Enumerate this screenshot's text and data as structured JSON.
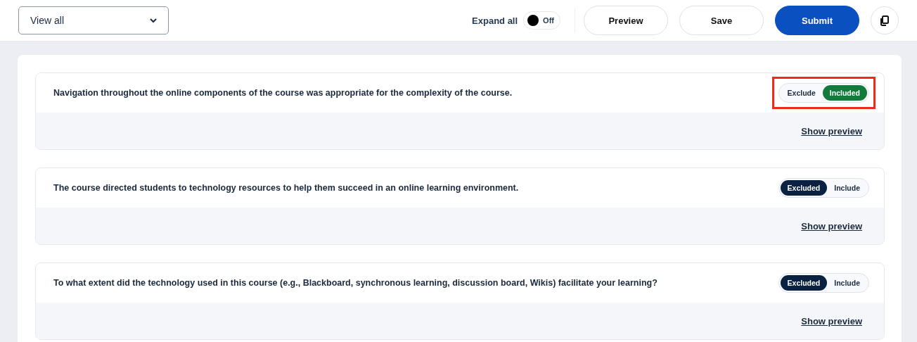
{
  "toolbar": {
    "filter": {
      "value": "View all"
    },
    "expand_all": {
      "label": "Expand all",
      "on": false,
      "state_label": "Off"
    },
    "buttons": [
      {
        "label": "Preview",
        "kind": "outline"
      },
      {
        "label": "Save",
        "kind": "outline"
      },
      {
        "label": "Submit",
        "kind": "primary"
      }
    ]
  },
  "questions": [
    {
      "text": "Navigation throughout the online components of the course was appropriate for the complexity of the course.",
      "highlighted": true,
      "options": [
        {
          "label": "Exclude",
          "selected": false
        },
        {
          "label": "Included",
          "selected": true
        }
      ],
      "link": "Show preview"
    },
    {
      "text": "The course directed students to technology resources to help them succeed in an online learning environment.",
      "highlighted": false,
      "options": [
        {
          "label": "Excluded",
          "selected": true
        },
        {
          "label": "Include",
          "selected": false
        }
      ],
      "link": "Show preview"
    },
    {
      "text": "To what extent did the technology used in this course (e.g., Blackboard, synchronous learning, discussion board, Wikis) facilitate your learning?",
      "highlighted": false,
      "options": [
        {
          "label": "Excluded",
          "selected": true
        },
        {
          "label": "Include",
          "selected": false
        }
      ],
      "link": "Show preview"
    }
  ]
}
